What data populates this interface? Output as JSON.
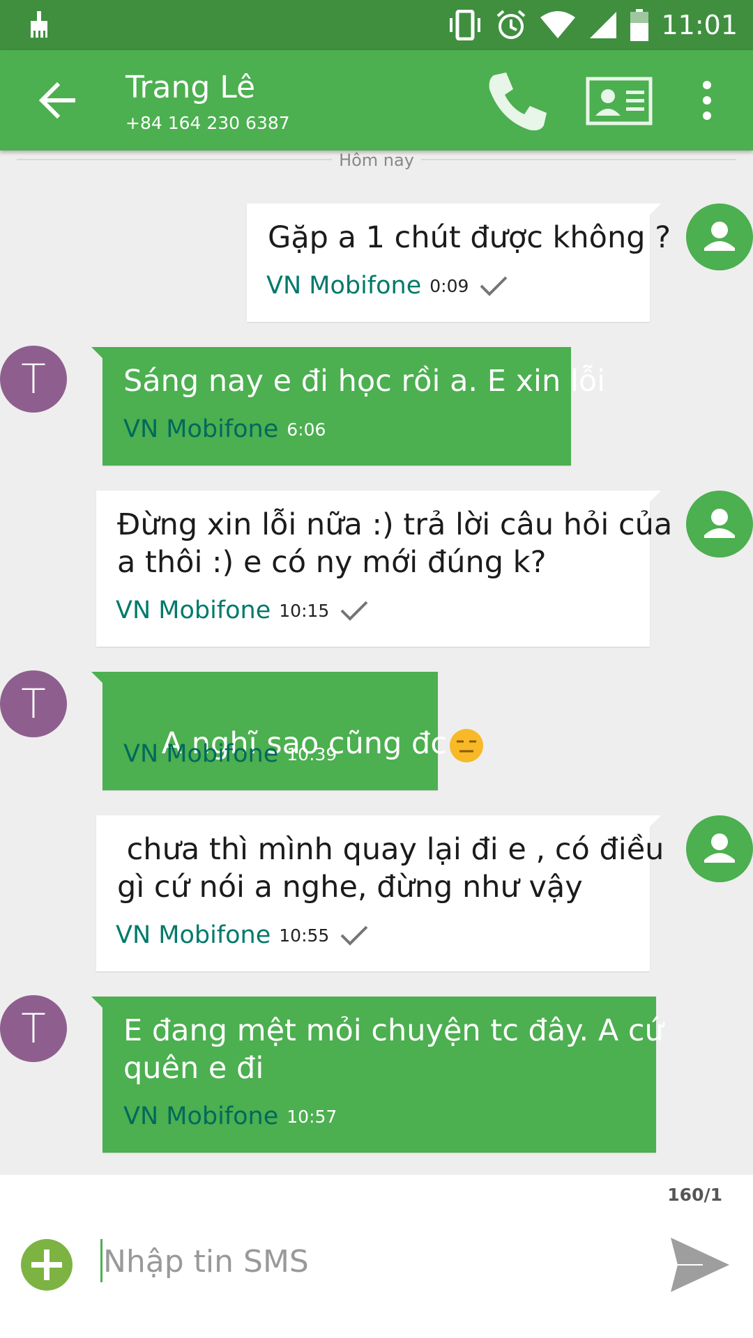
{
  "status_bar": {
    "time": "11:01",
    "icons": [
      "cleaner-icon",
      "vibrate-icon",
      "alarm-icon",
      "wifi-icon",
      "signal-icon",
      "battery-icon"
    ]
  },
  "header": {
    "contact_name": "Trang Lê",
    "contact_number": "+84 164 230 6387",
    "color": "#4caf50"
  },
  "date_divider": "Hôm nay",
  "messages": [
    {
      "direction": "outgoing",
      "lines": [
        "Gặp a 1 chút được không ?"
      ],
      "carrier": "VN Mobifone",
      "time": "0:09",
      "delivered": true
    },
    {
      "direction": "incoming",
      "sender_initial": "T",
      "lines": [
        "Sáng nay e đi học rồi a. E xin lỗi"
      ],
      "carrier": "VN Mobifone",
      "time": "6:06"
    },
    {
      "direction": "outgoing",
      "lines": [
        "Đừng xin lỗi nữa :) trả lời câu hỏi của",
        "a thôi :) e có ny mới đúng k?"
      ],
      "carrier": "VN Mobifone",
      "time": "10:15",
      "delivered": true
    },
    {
      "direction": "incoming",
      "sender_initial": "T",
      "lines": [
        "A nghĩ sao cũng đc"
      ],
      "emoji": "expressionless-face-emoji",
      "carrier": "VN Mobifone",
      "time": "10:39"
    },
    {
      "direction": "outgoing",
      "lines": [
        " chưa thì mình quay lại đi e , có điều",
        "gì cứ nói a nghe, đừng như vậy"
      ],
      "carrier": "VN Mobifone",
      "time": "10:55",
      "delivered": true
    },
    {
      "direction": "incoming",
      "sender_initial": "T",
      "lines": [
        "E đang mệt mỏi chuyện tc đây. A cứ",
        "quên e đi"
      ],
      "carrier": "VN Mobifone",
      "time": "10:57"
    }
  ],
  "composer": {
    "counter": "160/1",
    "placeholder": "Nhập tin SMS",
    "value": ""
  },
  "colors": {
    "status_bar": "#3f8f3f",
    "accent": "#4caf50",
    "carrier_text": "#00796b",
    "contact_avatar": "#8e5f8e",
    "background": "#eeeeee"
  }
}
